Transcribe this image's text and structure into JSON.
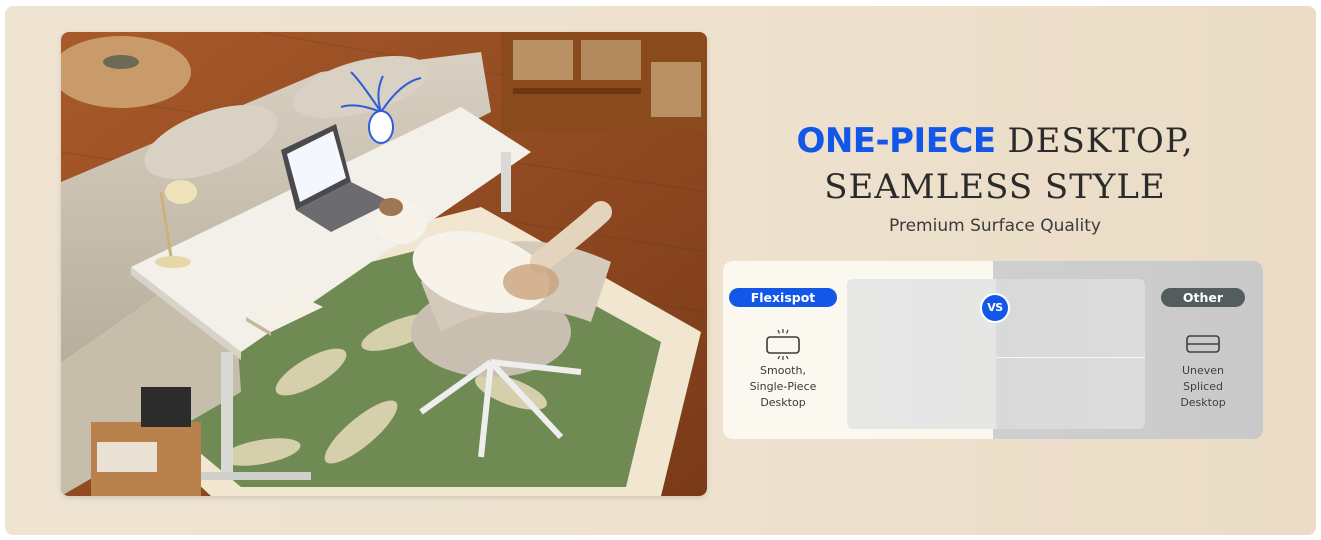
{
  "headline": {
    "accent": "ONE-PIECE",
    "line1_rest": "DESKTOP,",
    "line2": "SEAMLESS STYLE",
    "subtitle": "Premium Surface Quality",
    "accent_color": "#1357e8"
  },
  "comparison": {
    "left": {
      "badge": "Flexispot",
      "icon": "smooth-desktop-icon",
      "caption_lines": [
        "Smooth,",
        "Single-Piece",
        "Desktop"
      ]
    },
    "vs_label": "VS",
    "right": {
      "badge": "Other",
      "icon": "spliced-desktop-icon",
      "caption_lines": [
        "Uneven",
        "Spliced",
        "Desktop"
      ]
    },
    "brand_color": "#1357e8",
    "other_color": "#535d5e"
  },
  "photo": {
    "icon": "lifestyle-photo-standing-desk-cat"
  }
}
